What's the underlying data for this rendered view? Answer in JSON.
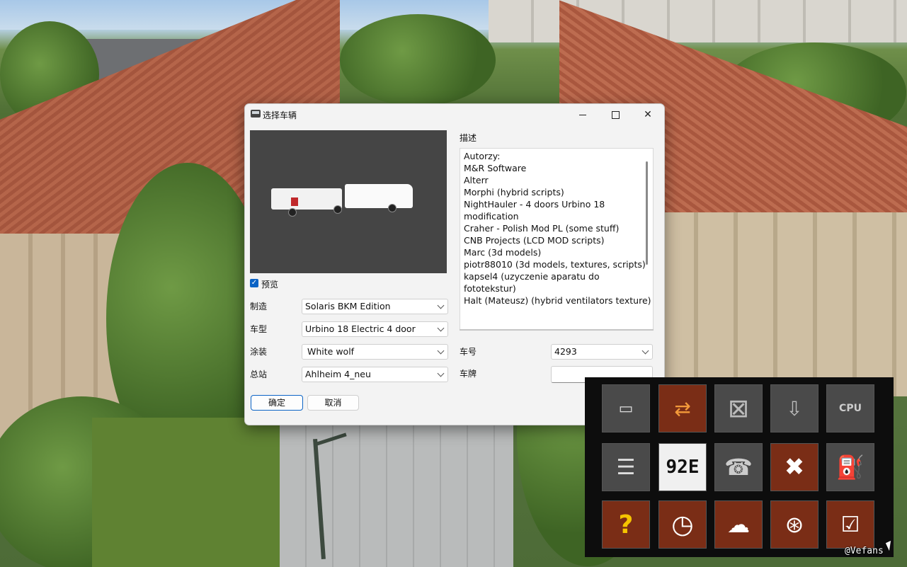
{
  "dialog": {
    "title": "选择车辆",
    "preview_label": "预览",
    "description_label": "描述",
    "fields": {
      "manufacturer_label": "制造",
      "manufacturer_value": "Solaris BKM Edition",
      "model_label": "车型",
      "model_value": "Urbino 18 Electric 4 door",
      "livery_label": "涂装",
      "livery_value": "White wolf",
      "depot_label": "总站",
      "depot_value": "Ahlheim 4_neu",
      "number_label": "车号",
      "number_value": "4293",
      "plate_label": "车牌",
      "plate_value": ""
    },
    "description_lines": [
      "Autorzy:",
      "M&R Software",
      "Alterr",
      "Morphi (hybrid scripts)",
      "NightHauler - 4 doors Urbino 18",
      "modification",
      "Craher - Polish Mod PL (some stuff)",
      "CNB Projects (LCD MOD scripts)",
      "Marc (3d models)",
      "piotr88010 (3d models, textures, scripts)",
      "kapsel4 (uzyczenie aparatu do",
      "fototekstur)",
      "Halt (Mateusz) (hybrid ventilators texture)"
    ],
    "ok_label": "确定",
    "cancel_label": "取消"
  },
  "toolbar": {
    "tiles": [
      {
        "icon": "bus-swap-icon"
      },
      {
        "icon": "bus-remove-icon"
      },
      {
        "icon": "bus-insert-icon"
      },
      {
        "icon": "bus-cpu-icon"
      },
      {
        "icon": "timetable-icon"
      },
      {
        "icon": "route-display-icon",
        "text": "92E"
      },
      {
        "icon": "accident-icon"
      },
      {
        "icon": "repair-tools-icon"
      },
      {
        "icon": "fuel-pump-icon"
      },
      {
        "icon": "help-icon"
      },
      {
        "icon": "clock-icon"
      },
      {
        "icon": "weather-icon"
      },
      {
        "icon": "driver-icon"
      },
      {
        "icon": "passenger-checklist-icon"
      }
    ]
  },
  "watermark": "@Vefans",
  "colors": {
    "accent": "#0b63c5",
    "tile_rust": "#7a2d16",
    "tile_gray": "#4a4a4a"
  }
}
